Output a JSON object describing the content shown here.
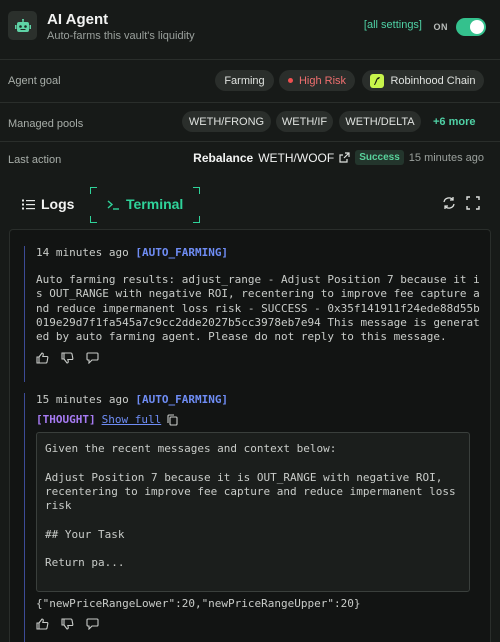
{
  "header": {
    "title": "AI Agent",
    "subtitle": "Auto-farms this vault's liquidity",
    "all_settings": "[all settings]",
    "toggle_label": "ON",
    "toggle_on": true,
    "accent": "#34c18d"
  },
  "goal": {
    "label": "Agent goal",
    "chips": [
      "Farming",
      "High Risk",
      "Robinhood Chain"
    ]
  },
  "pools": {
    "label": "Managed pools",
    "items": [
      "WETH/FRONG",
      "WETH/IF",
      "WETH/DELTA"
    ],
    "more": "+6 more"
  },
  "last_action": {
    "label": "Last action",
    "action": "Rebalance",
    "pool": "WETH/WOOF",
    "status": "Success",
    "time": "15 minutes ago"
  },
  "tabs": {
    "logs": "Logs",
    "terminal": "Terminal"
  },
  "logs": [
    {
      "time": "14 minutes ago",
      "tag": "[AUTO_FARMING]",
      "body": "Auto farming results: adjust_range - Adjust Position 7 because it is OUT_RANGE with negative ROI, recentering to improve fee capture and reduce impermanent loss risk - SUCCESS - 0x35f141911f24ede88d55b019e29d7f1fa545a7c9cc2dde2027b5cc3978eb7e94 This message is generated by auto farming agent. Please do not reply to this message."
    },
    {
      "time": "15 minutes ago",
      "tag": "[AUTO_FARMING]",
      "thought_tag": "[THOUGHT]",
      "show_full": "Show full",
      "thought": "Given the recent messages and context below:\n\nAdjust Position 7 because it is OUT_RANGE with negative ROI, recentering to improve fee capture and reduce impermanent loss risk\n\n## Your Task\n\nReturn pa...",
      "json": "{\"newPriceRangeLower\":20,\"newPriceRangeUpper\":20}"
    }
  ]
}
